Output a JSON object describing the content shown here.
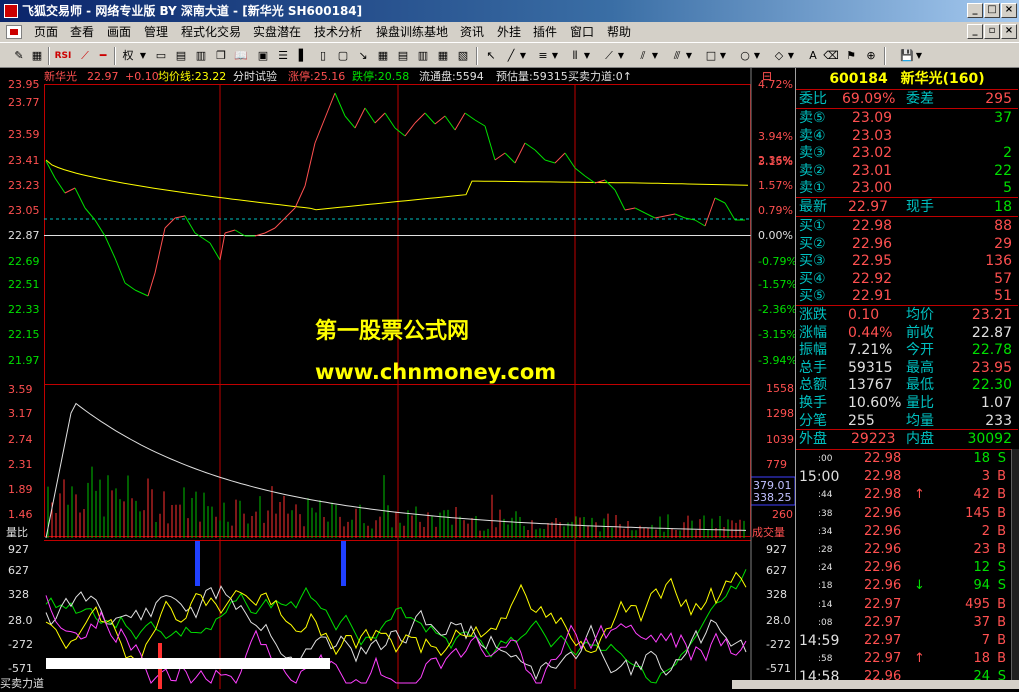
{
  "window": {
    "title": "飞狐交易师 - 网络专业版 BY 深南大道 - [新华光 SH600184]"
  },
  "menu": {
    "items": [
      "页面",
      "查看",
      "画面",
      "管理",
      "程式化交易",
      "实盘潜在",
      "技术分析",
      "操盘训练基地",
      "资讯",
      "外挂",
      "插件",
      "窗口",
      "帮助"
    ]
  },
  "toolbar": {
    "labels": {
      "rsi": "RSI",
      "quan": "权"
    }
  },
  "header": {
    "name": "新华光",
    "price": "22.97",
    "change": "+0.10",
    "avg_label": "均价线:23.22",
    "mode": "分时试验",
    "limit_up": "涨停:25.16",
    "limit_down": "跌停:20.58",
    "float": "流通盘:5594",
    "estimate": "预估量:59315",
    "force": "买卖力道:0↑"
  },
  "price_axis": {
    "left": [
      "23.95",
      "23.77",
      "23.59",
      "23.41",
      "23.23",
      "23.05",
      "22.87",
      "22.69",
      "22.51",
      "22.33",
      "22.15",
      "21.97"
    ],
    "right": [
      "4.72%",
      "3.94%",
      "3.15%",
      "2.36%",
      "1.57%",
      "0.79%",
      "0.00%",
      "-0.79%",
      "-1.57%",
      "-2.36%",
      "-3.15%",
      "-3.94%"
    ]
  },
  "volume_axis": {
    "left": [
      "3.59",
      "3.17",
      "2.74",
      "2.31",
      "1.89",
      "1.46",
      "量比"
    ],
    "right": [
      "1558",
      "1298",
      "1039",
      "779",
      "379.01",
      "338.25",
      "260",
      "成交量"
    ]
  },
  "indicator_axis": {
    "left": [
      "927",
      "627",
      "328",
      "28.0",
      "-272",
      "-571",
      "买卖力道"
    ],
    "right": [
      "927",
      "627",
      "328",
      "28.0",
      "-272",
      "-571"
    ]
  },
  "watermark": {
    "line1": "第一股票公式网",
    "line2": "www.chnmoney.com"
  },
  "quote": {
    "code": "600184",
    "name": "新华光(160)",
    "weibi": {
      "label": "委比",
      "value": "69.09%",
      "label2": "委差",
      "value2": "295"
    },
    "sells": [
      {
        "label": "卖⑤",
        "price": "23.09",
        "vol": "37"
      },
      {
        "label": "卖④",
        "price": "23.03",
        "vol": ""
      },
      {
        "label": "卖③",
        "price": "23.02",
        "vol": "2"
      },
      {
        "label": "卖②",
        "price": "23.01",
        "vol": "22"
      },
      {
        "label": "卖①",
        "price": "23.00",
        "vol": "5"
      }
    ],
    "last": {
      "label": "最新",
      "value": "22.97",
      "label2": "现手",
      "value2": "18"
    },
    "buys": [
      {
        "label": "买①",
        "price": "22.98",
        "vol": "88"
      },
      {
        "label": "买②",
        "price": "22.96",
        "vol": "29"
      },
      {
        "label": "买③",
        "price": "22.95",
        "vol": "136"
      },
      {
        "label": "买④",
        "price": "22.92",
        "vol": "57"
      },
      {
        "label": "买⑤",
        "price": "22.91",
        "vol": "51"
      }
    ],
    "stats": [
      {
        "l1": "涨跌",
        "v1": "0.10",
        "l2": "均价",
        "v2": "23.21"
      },
      {
        "l1": "涨幅",
        "v1": "0.44%",
        "l2": "前收",
        "v2": "22.87"
      },
      {
        "l1": "振幅",
        "v1": "7.21%",
        "l2": "今开",
        "v2": "22.78"
      },
      {
        "l1": "总手",
        "v1": "59315",
        "l2": "最高",
        "v2": "23.95"
      },
      {
        "l1": "总额",
        "v1": "13767",
        "l2": "最低",
        "v2": "22.30"
      },
      {
        "l1": "换手",
        "v1": "10.60%",
        "l2": "量比",
        "v2": "1.07"
      },
      {
        "l1": "分笔",
        "v1": "255",
        "l2": "均量",
        "v2": "233"
      }
    ],
    "outer": {
      "label": "外盘",
      "value": "29223",
      "label2": "内盘",
      "value2": "30092"
    }
  },
  "ticks": [
    {
      "time": ":00",
      "price": "22.98",
      "arrow": "",
      "vol": "18",
      "side": "S"
    },
    {
      "time": "15:00",
      "price": "22.98",
      "arrow": "",
      "vol": "3",
      "side": "B"
    },
    {
      "time": ":44",
      "price": "22.98",
      "arrow": "↑",
      "vol": "42",
      "side": "B"
    },
    {
      "time": ":38",
      "price": "22.96",
      "arrow": "",
      "vol": "145",
      "side": "B"
    },
    {
      "time": ":34",
      "price": "22.96",
      "arrow": "",
      "vol": "2",
      "side": "B"
    },
    {
      "time": ":28",
      "price": "22.96",
      "arrow": "",
      "vol": "23",
      "side": "B"
    },
    {
      "time": ":24",
      "price": "22.96",
      "arrow": "",
      "vol": "12",
      "side": "S"
    },
    {
      "time": ":18",
      "price": "22.96",
      "arrow": "↓",
      "vol": "94",
      "side": "S"
    },
    {
      "time": ":14",
      "price": "22.97",
      "arrow": "",
      "vol": "495",
      "side": "B"
    },
    {
      "time": ":08",
      "price": "22.97",
      "arrow": "",
      "vol": "37",
      "side": "B"
    },
    {
      "time": "14:59",
      "price": "22.97",
      "arrow": "",
      "vol": "7",
      "side": "B"
    },
    {
      "time": ":58",
      "price": "22.97",
      "arrow": "↑",
      "vol": "18",
      "side": "B"
    },
    {
      "time": "14:58",
      "price": "22.96",
      "arrow": "",
      "vol": "24",
      "side": "S"
    }
  ],
  "colors": {
    "up": "#ff5050",
    "down": "#00e000",
    "grid": "#c00000",
    "avg": "#ffff00"
  }
}
